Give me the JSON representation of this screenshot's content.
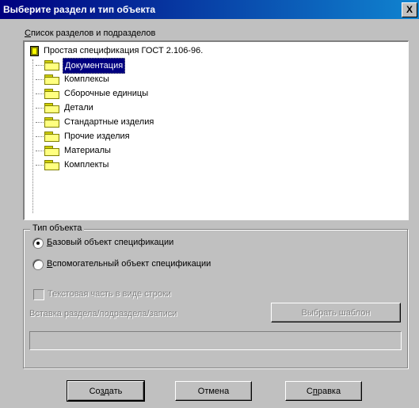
{
  "window": {
    "title": "Выберите раздел и тип объекта",
    "close_glyph": "X"
  },
  "section_list": {
    "label_prefix": "С",
    "label_rest": "писок разделов и подразделов",
    "root": "Простая спецификация ГОСТ 2.106-96.",
    "items": [
      {
        "label": "Документация",
        "selected": true
      },
      {
        "label": "Комплексы"
      },
      {
        "label": "Сборочные единицы"
      },
      {
        "label": "Детали"
      },
      {
        "label": "Стандартные изделия"
      },
      {
        "label": "Прочие изделия"
      },
      {
        "label": "Материалы"
      },
      {
        "label": "Комплекты"
      }
    ]
  },
  "object_type": {
    "legend": "Тип объекта",
    "base_prefix": "Б",
    "base_rest": "азовый объект спецификации",
    "aux_prefix": "В",
    "aux_rest": "спомогательный объект спецификации",
    "base_selected": true
  },
  "disabled_section": {
    "check_label": "Текстовая часть в виде строки",
    "hint": "Вставка раздела/подраздела/записи",
    "button": "Выбрать шаблон"
  },
  "buttons": {
    "create_prefix": "Со",
    "create_u": "з",
    "create_rest": "дать",
    "cancel": "Отмена",
    "help_prefix": "С",
    "help_u": "п",
    "help_rest": "равка"
  },
  "colors": {
    "title_bar": "#00007f",
    "selection": "#000080",
    "face": "#c0c0c0"
  }
}
